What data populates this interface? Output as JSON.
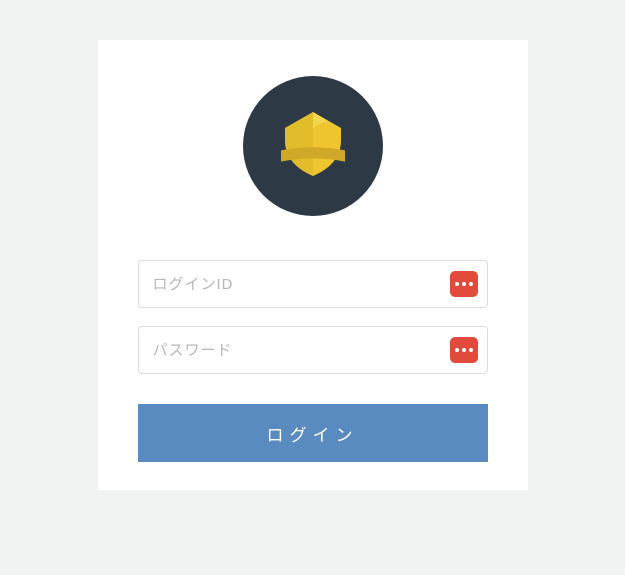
{
  "logo": {
    "icon": "shield-icon"
  },
  "fields": {
    "login_id": {
      "placeholder": "ログインID",
      "value": ""
    },
    "password": {
      "placeholder": "パスワード",
      "value": ""
    }
  },
  "buttons": {
    "login_label": "ログイン"
  },
  "colors": {
    "page_bg": "#f1f2f2",
    "card_bg": "#ffffff",
    "logo_bg": "#2e3946",
    "shield": "#eec52f",
    "shield_dark": "#d0a827",
    "input_border": "#dcdcdc",
    "placeholder": "#b7b7b7",
    "badge": "#e24a3b",
    "primary_btn": "#5a8bc0"
  }
}
